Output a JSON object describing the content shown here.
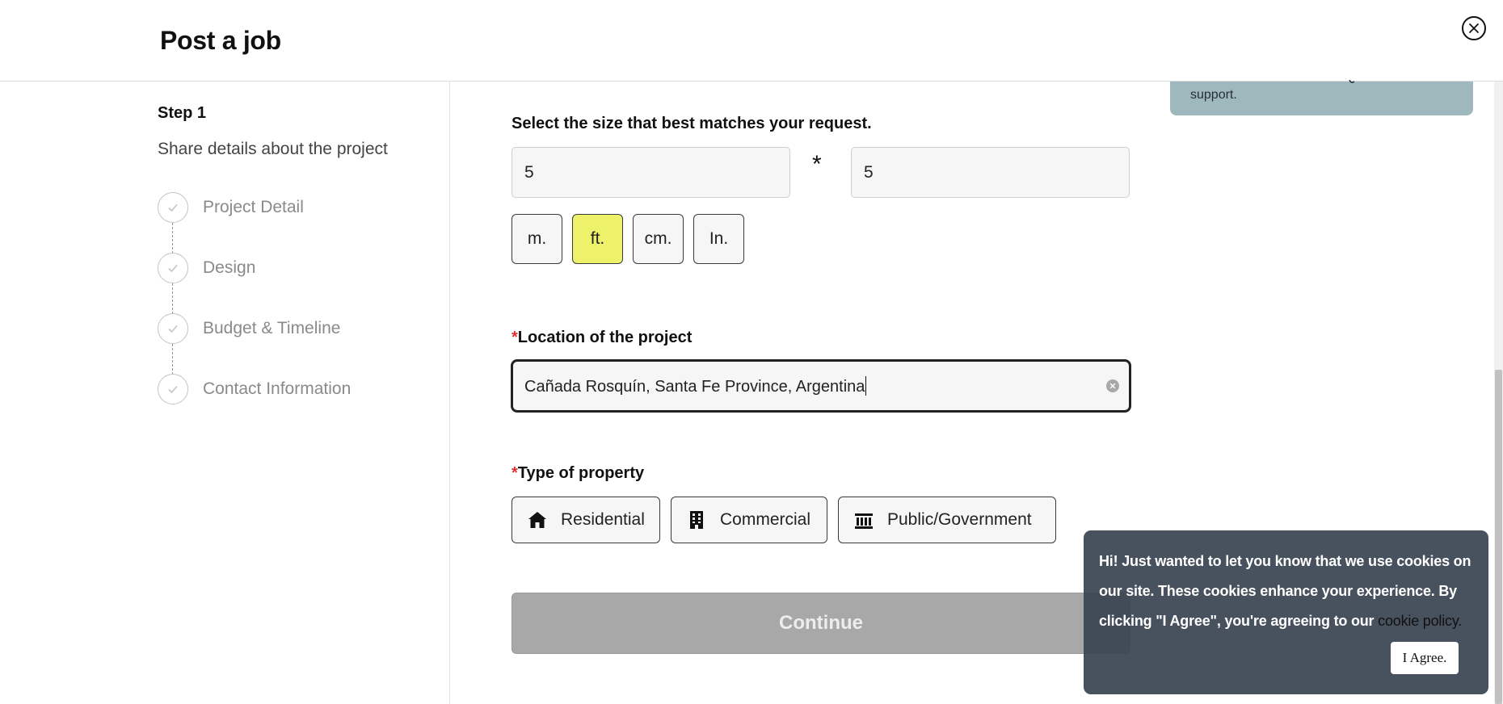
{
  "header": {
    "title": "Post a job"
  },
  "sidebar": {
    "step_label": "Step 1",
    "step_description": "Share details about the project",
    "steps": [
      {
        "label": "Project Detail"
      },
      {
        "label": "Design"
      },
      {
        "label": "Budget & Timeline"
      },
      {
        "label": "Contact Information"
      }
    ]
  },
  "info_card": {
    "text": "support."
  },
  "size": {
    "label": "Select the size that best matches your request.",
    "width_value": "5",
    "height_value": "5",
    "separator": "*",
    "units": [
      {
        "label": "m.",
        "selected": false
      },
      {
        "label": "ft.",
        "selected": true
      },
      {
        "label": "cm.",
        "selected": false
      },
      {
        "label": "In.",
        "selected": false
      }
    ]
  },
  "location": {
    "required_mark": "*",
    "label": "Location of the project",
    "value": "Cañada Rosquín, Santa Fe Province, Argentina"
  },
  "property": {
    "required_mark": "*",
    "label": "Type of property",
    "options": [
      {
        "label": "Residential",
        "icon": "house-icon"
      },
      {
        "label": "Commercial",
        "icon": "office-building-icon"
      },
      {
        "label": "Public/Government",
        "icon": "government-building-icon"
      }
    ]
  },
  "continue": {
    "label": "Continue"
  },
  "cookie_banner": {
    "message": "Hi! Just wanted to let you know that we use cookies on our site. These cookies enhance your experience. By clicking \"I Agree\", you're agreeing to our",
    "link_text": "cookie policy.",
    "button_label": "I Agree."
  },
  "colors": {
    "selected_unit_bg": "#eef26a",
    "required_mark": "#e23030",
    "info_card_bg": "#9fb8bd",
    "continue_disabled_bg": "#a8a8a8",
    "cookie_bg": "#3a4452"
  }
}
